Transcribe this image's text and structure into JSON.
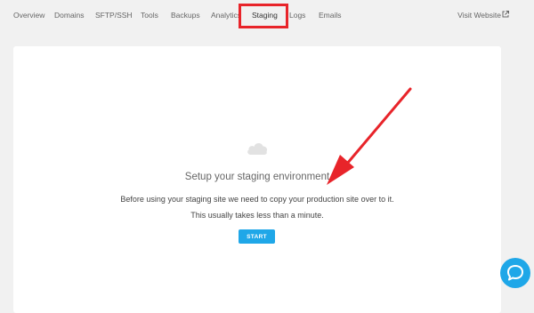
{
  "nav": {
    "tabs": [
      {
        "label": "Overview"
      },
      {
        "label": "Domains"
      },
      {
        "label": "SFTP/SSH"
      },
      {
        "label": "Tools"
      },
      {
        "label": "Backups"
      },
      {
        "label": "Analytics"
      },
      {
        "label": "Staging",
        "active": true
      },
      {
        "label": "Logs"
      },
      {
        "label": "Emails"
      }
    ],
    "visit_website": "Visit Website"
  },
  "main": {
    "heading": "Setup your staging environment",
    "description_line1": "Before using your staging site we need to copy your production site over to it.",
    "description_line2": "This usually takes less than a minute.",
    "start_label": "START"
  },
  "icons": {
    "cloud": "cloud-icon",
    "external_link": "external-link-icon",
    "chat": "chat-bubble-icon"
  },
  "colors": {
    "accent": "#1fa7e8",
    "annotation_red": "#e8242a",
    "background": "#f1f1f1",
    "panel": "#ffffff"
  }
}
